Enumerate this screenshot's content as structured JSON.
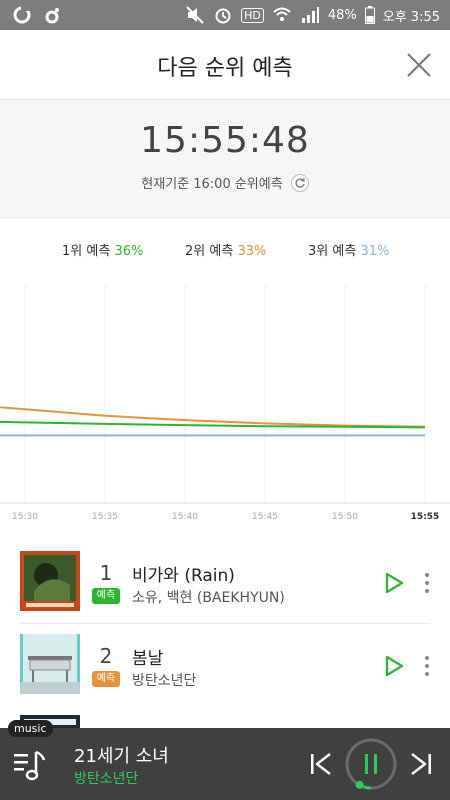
{
  "status_bar": {
    "battery": "48%",
    "time": "오후 3:55",
    "left_icons": [
      "app-o-icon",
      "app-o-small-icon"
    ],
    "right_icons": [
      "mute-icon",
      "alarm-icon",
      "hd-icon",
      "wifi-icon",
      "signal-icon",
      "battery-icon"
    ],
    "hd_label": "HD"
  },
  "header": {
    "title": "다음 순위 예측",
    "close_icon": "close-icon"
  },
  "clock": {
    "time": "15:55:48",
    "basis": "현재기준 16:00 순위예측",
    "refresh_icon": "refresh-icon"
  },
  "legend": {
    "items": [
      {
        "label": "1위 예측",
        "value": "36%",
        "color": "#2db52d"
      },
      {
        "label": "2위 예측",
        "value": "33%",
        "color": "#e8923b"
      },
      {
        "label": "3위 예측",
        "value": "31%",
        "color": "#8ab6e0"
      }
    ]
  },
  "chart_data": {
    "type": "line",
    "x": [
      "15:30",
      "15:35",
      "15:40",
      "15:45",
      "15:50",
      "15:55"
    ],
    "x_bold_last": true,
    "series": [
      {
        "color": "#e8923b",
        "values": [
          0.43,
          0.4,
          0.38,
          0.365,
          0.355,
          0.35
        ]
      },
      {
        "color": "#2db52d",
        "values": [
          0.37,
          0.363,
          0.357,
          0.352,
          0.35,
          0.347
        ]
      },
      {
        "color": "#8ab6e0",
        "values": [
          0.31,
          0.31,
          0.31,
          0.31,
          0.31,
          0.31
        ]
      }
    ],
    "ylim": [
      0,
      1
    ],
    "grid": "vertical"
  },
  "list": {
    "items": [
      {
        "rank": "1",
        "badge": "예측",
        "badge_color": "#2db52d",
        "title": "비가와 (Rain)",
        "artist": "소유, 백현 (BAEKHYUN)",
        "play_icon": "play-icon",
        "more_icon": "more-vertical-icon"
      },
      {
        "rank": "2",
        "badge": "예측",
        "badge_color": "#e8923b",
        "title": "봄날",
        "artist": "방탄소년단",
        "play_icon": "play-icon",
        "more_icon": "more-vertical-icon"
      }
    ]
  },
  "player": {
    "tag": "music",
    "title": "21세기 소녀",
    "artist": "방탄소년단",
    "progress": 0.05,
    "queue_icon": "playlist-music-icon",
    "prev_icon": "skip-previous-icon",
    "pause_icon": "pause-icon",
    "next_icon": "skip-next-icon",
    "accent": "#34c759"
  }
}
